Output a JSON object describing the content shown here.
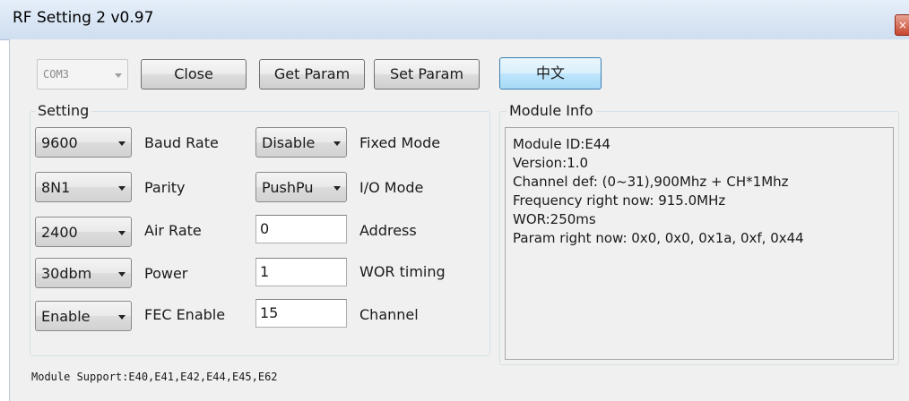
{
  "window": {
    "title": "RF Setting 2 v0.97",
    "close_glyph": "×"
  },
  "toolbar": {
    "com_port": "COM3",
    "close_label": "Close",
    "get_param_label": "Get Param",
    "set_param_label": "Set Param",
    "language_label": "中文"
  },
  "setting": {
    "group_label": "Setting",
    "baud_rate": {
      "value": "9600",
      "label": "Baud Rate"
    },
    "parity": {
      "value": "8N1",
      "label": "Parity"
    },
    "air_rate": {
      "value": "2400",
      "label": "Air Rate"
    },
    "power": {
      "value": "30dbm",
      "label": "Power"
    },
    "fec": {
      "value": "Enable",
      "label": "FEC Enable"
    },
    "fixed_mode": {
      "value": "Disable",
      "label": "Fixed Mode"
    },
    "io_mode": {
      "value": "PushPu",
      "label": "I/O Mode"
    },
    "address": {
      "value": "0",
      "label": "Address"
    },
    "wor_timing": {
      "value": "1",
      "label": "WOR timing"
    },
    "channel": {
      "value": "15",
      "label": "Channel"
    }
  },
  "module_info": {
    "group_label": "Module Info",
    "lines": [
      "Module ID:E44",
      "Version:1.0",
      "Channel def: (0~31),900Mhz + CH*1Mhz",
      "Frequency right now: 915.0MHz",
      "WOR:250ms",
      "Param right now: 0x0, 0x0, 0x1a, 0xf, 0x44"
    ]
  },
  "footer": {
    "support_text": "Module Support:E40,E41,E42,E44,E45,E62"
  }
}
